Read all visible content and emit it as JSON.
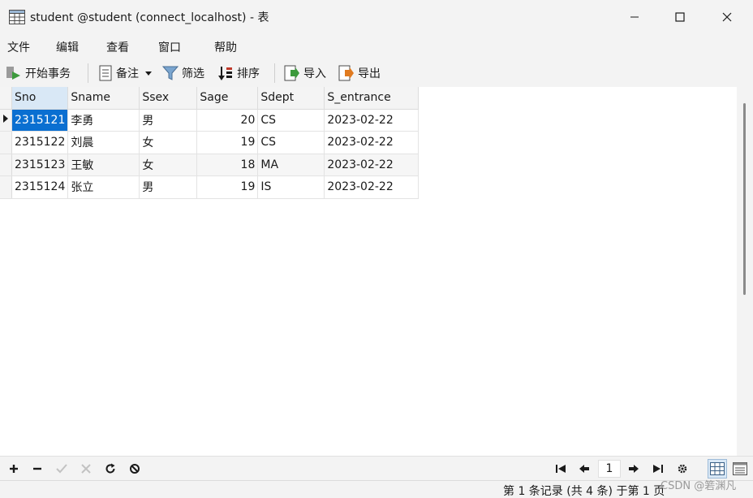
{
  "window": {
    "title": "student @student (connect_localhost) - 表"
  },
  "menu": [
    "文件",
    "编辑",
    "查看",
    "窗口",
    "帮助"
  ],
  "toolbar": {
    "begin_transaction": "开始事务",
    "notes": "备注",
    "filter": "筛选",
    "sort": "排序",
    "import": "导入",
    "export": "导出"
  },
  "grid": {
    "columns": [
      "Sno",
      "Sname",
      "Ssex",
      "Sage",
      "Sdept",
      "S_entrance"
    ],
    "rows": [
      [
        "2315121",
        "李勇",
        "男",
        "20",
        "CS",
        "2023-02-22"
      ],
      [
        "2315122",
        "刘晨",
        "女",
        "19",
        "CS",
        "2023-02-22"
      ],
      [
        "2315123",
        "王敏",
        "女",
        "18",
        "MA",
        "2023-02-22"
      ],
      [
        "2315124",
        "张立",
        "男",
        "19",
        "IS",
        "2023-02-22"
      ]
    ]
  },
  "pagination": {
    "current_page": "1"
  },
  "status": {
    "text": "第 1 条记录 (共 4 条) 于第 1 页"
  },
  "watermark": "CSDN @箬渊凡",
  "colors": {
    "selection": "#0a6fd1",
    "accent_green": "#3c9a3c",
    "accent_blue": "#2f6fb8"
  }
}
